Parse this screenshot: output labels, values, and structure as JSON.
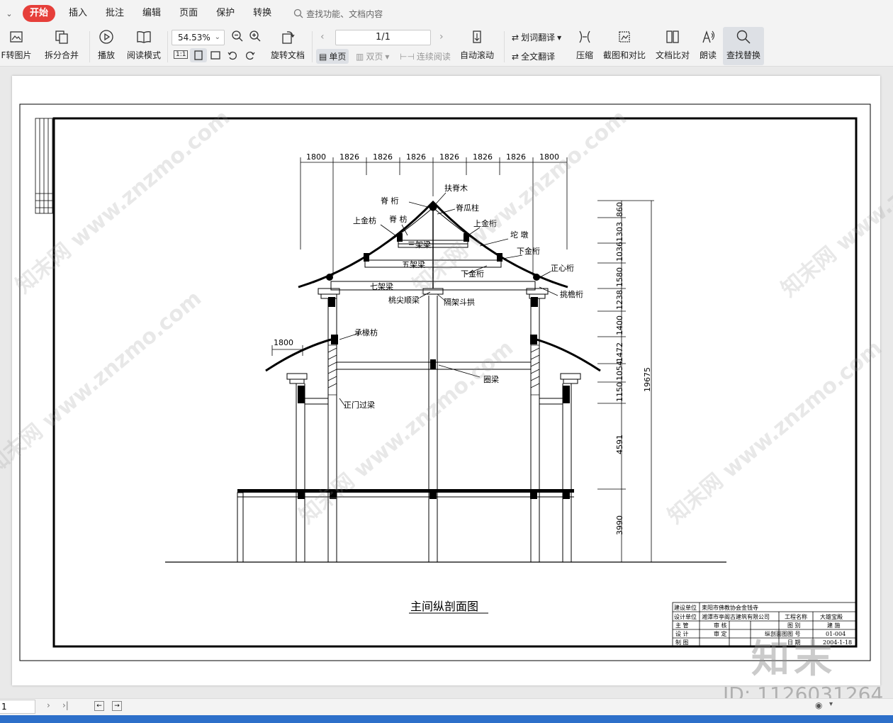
{
  "menu": {
    "tabs": [
      "开始",
      "插入",
      "批注",
      "编辑",
      "页面",
      "保护",
      "转换"
    ],
    "search_placeholder": "查找功能、文档内容"
  },
  "ribbon": {
    "pdf_to_image": "F转图片",
    "split_merge": "拆分合并",
    "play": "播放",
    "read_mode": "阅读模式",
    "zoom_value": "54.53%",
    "fit_label": "1:1",
    "rotate_doc": "旋转文档",
    "page_value": "1/1",
    "single_page": "单页",
    "double_page": "双页",
    "continuous": "连续阅读",
    "auto_scroll": "自动滚动",
    "word_translate": "划词翻译",
    "full_translate": "全文翻译",
    "compress": "压缩",
    "screenshot_compare": "截图和对比",
    "doc_compare": "文档比对",
    "read_aloud": "朗读",
    "find_replace": "查找替换"
  },
  "drawing": {
    "title": "主间纵剖面图",
    "top_dims": [
      "1800",
      "1826",
      "1826",
      "1826",
      "1826",
      "1826",
      "1826",
      "1800"
    ],
    "side_dim": "1800",
    "right_dims": [
      "860",
      "1303",
      "1036",
      "1580",
      "1238",
      "1400",
      "1472",
      "1054",
      "1150",
      "4591",
      "3990"
    ],
    "total_height": "19675",
    "labels": {
      "fujimu": "扶脊木",
      "jiheng": "脊 桁",
      "jiguazhu": "脊瓜柱",
      "shangjinfang": "上金枋",
      "jifang": "脊 枋",
      "shangjinheng": "上金桁",
      "sanjialiang": "三架梁",
      "tuodun": "坨 墩",
      "xiajinheng1": "下金桁",
      "wujialiang": "五架梁",
      "xiajinheng2": "下金桁",
      "zhengxinheng": "正心桁",
      "qijialiang": "七架梁",
      "tiaoyanheng": "挑檐桁",
      "taojianshunliang": "桃尖顺梁",
      "gejiadougong": "隔架斗拱",
      "chengchuanfang": "承椽枋",
      "quanliang": "圈梁",
      "zhengmenguoliang": "正门过梁"
    },
    "title_block": {
      "jianshe_label": "建设单位",
      "jianshe_value": "耒阳市佛教协会金钱寺",
      "sheji_label": "设计单位",
      "sheji_value": "湘潭市亭阁古建筑有限公司",
      "project_label": "工程名称",
      "project_value": "大雄宝殿",
      "zhuguan": "主 管",
      "shenhe": "审 核",
      "sheji": "设 计",
      "shending": "审 定",
      "zhitu": "制 图",
      "drawing_name": "纵剖面图",
      "tubie_label": "图 别",
      "tubie_value": "建 施",
      "tuhao_label": "图 号",
      "tuhao_value": "01-004",
      "riqi_label": "日 期",
      "riqi_value": "2004-1-18"
    }
  },
  "watermarks": [
    "知末网 www.znzmo.com"
  ],
  "id_text": "ID: 1126031264",
  "zhi_mark": "知末",
  "status": {
    "page_input": "1"
  }
}
